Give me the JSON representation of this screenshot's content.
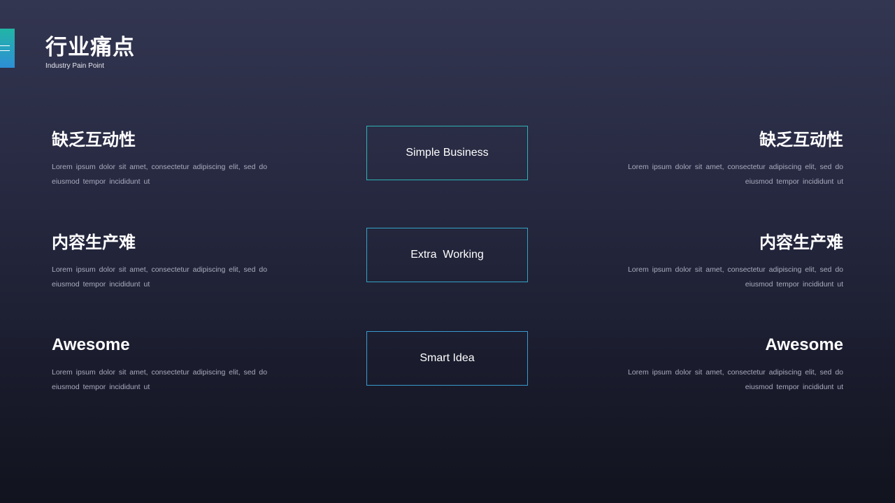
{
  "header": {
    "title": "行业痛点",
    "subtitle": "Industry Pain Point"
  },
  "left_blocks": [
    {
      "heading": "缺乏互动性",
      "body_line1": "Lorem ipsum dolor sit amet, consectetur adipiscing elit, sed do",
      "body_line2": "eiusmod tempor incididunt ut"
    },
    {
      "heading": "内容生产难",
      "body_line1": "Lorem ipsum dolor sit amet, consectetur adipiscing elit, sed do",
      "body_line2": "eiusmod tempor incididunt ut"
    },
    {
      "heading": "Awesome",
      "body_line1": "Lorem ipsum dolor sit amet, consectetur adipiscing elit, sed do",
      "body_line2": "eiusmod tempor incididunt ut"
    }
  ],
  "center_boxes": [
    {
      "label": "Simple Business"
    },
    {
      "label": "Extra  Working"
    },
    {
      "label": "Smart Idea"
    }
  ],
  "right_blocks": [
    {
      "heading": "缺乏互动性",
      "body_line1": "Lorem ipsum dolor sit amet, consectetur adipiscing elit, sed do",
      "body_line2": "eiusmod tempor incididunt ut"
    },
    {
      "heading": "内容生产难",
      "body_line1": "Lorem ipsum dolor sit amet, consectetur adipiscing elit, sed do",
      "body_line2": "eiusmod tempor incididunt ut"
    },
    {
      "heading": "Awesome",
      "body_line1": "Lorem ipsum dolor sit amet, consectetur adipiscing elit, sed do",
      "body_line2": "eiusmod tempor incididunt ut"
    }
  ],
  "colors": {
    "accent_top": "#22b5a6",
    "accent_bottom": "#2d8fd6",
    "box_border": "#3a9ec7",
    "body_text": "#a9abbd"
  }
}
